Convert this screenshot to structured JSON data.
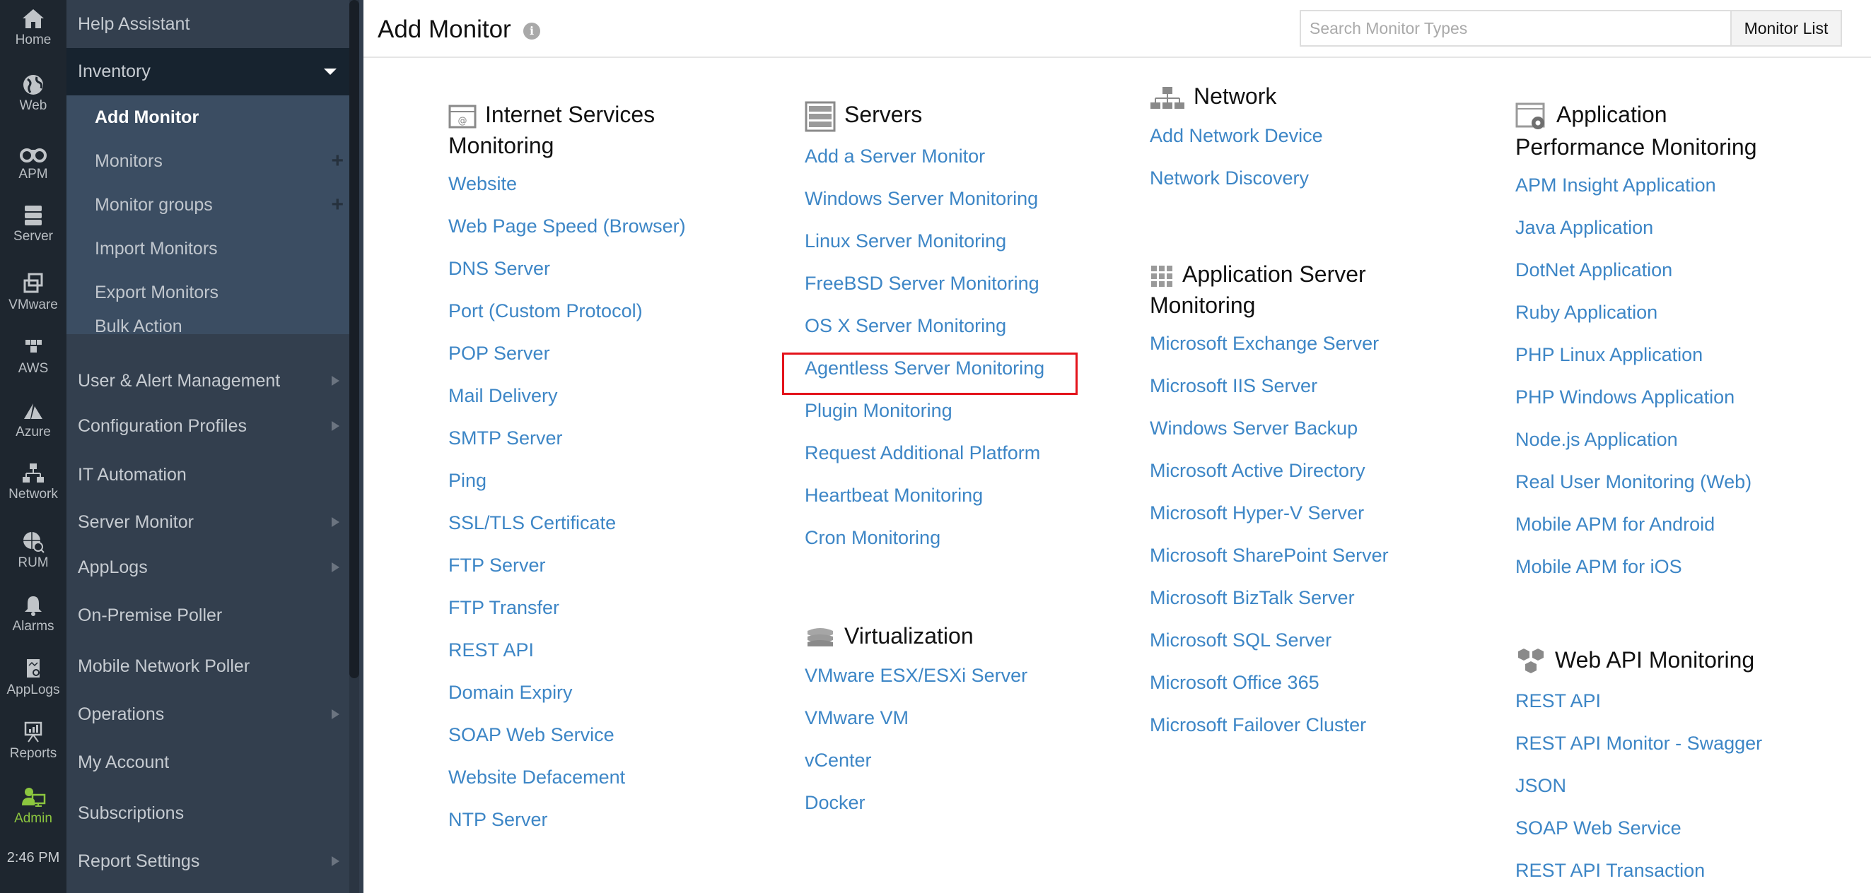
{
  "rail": {
    "items": [
      {
        "label": "Home",
        "icon": "home-icon"
      },
      {
        "label": "Web",
        "icon": "globe-icon"
      },
      {
        "label": "APM",
        "icon": "binoculars-icon"
      },
      {
        "label": "Server",
        "icon": "server-icon"
      },
      {
        "label": "VMware",
        "icon": "vmware-icon"
      },
      {
        "label": "AWS",
        "icon": "aws-cubes-icon"
      },
      {
        "label": "Azure",
        "icon": "azure-icon"
      },
      {
        "label": "Network",
        "icon": "network-icon"
      },
      {
        "label": "RUM",
        "icon": "rum-globe-icon"
      },
      {
        "label": "Alarms",
        "icon": "bell-icon"
      },
      {
        "label": "AppLogs",
        "icon": "applogs-icon"
      },
      {
        "label": "Reports",
        "icon": "reports-icon"
      },
      {
        "label": "Admin",
        "icon": "admin-icon",
        "active": true
      }
    ],
    "time": "2:46 PM",
    "active_color": "#8cc63f"
  },
  "nav": {
    "help": "Help Assistant",
    "inventory": "Inventory",
    "inventory_sub": [
      "Add Monitor",
      "Monitors",
      "Monitor groups",
      "Import Monitors",
      "Export Monitors",
      "Bulk Action"
    ],
    "items": [
      {
        "label": "User & Alert Management",
        "has_arrow": true
      },
      {
        "label": "Configuration Profiles",
        "has_arrow": true
      },
      {
        "label": "IT Automation",
        "has_arrow": false
      },
      {
        "label": "Server Monitor",
        "has_arrow": true
      },
      {
        "label": "AppLogs",
        "has_arrow": true
      },
      {
        "label": "On-Premise Poller",
        "has_arrow": false
      },
      {
        "label": "Mobile Network Poller",
        "has_arrow": false
      },
      {
        "label": "Operations",
        "has_arrow": true
      },
      {
        "label": "My Account",
        "has_arrow": false
      },
      {
        "label": "Subscriptions",
        "has_arrow": false
      },
      {
        "label": "Report Settings",
        "has_arrow": true
      }
    ]
  },
  "header": {
    "title": "Add Monitor",
    "search_placeholder": "Search Monitor Types",
    "search_value": "",
    "monitor_list_label": "Monitor List"
  },
  "sections": {
    "internet": {
      "title_line1": "Internet Services",
      "title_line2": "Monitoring",
      "links": [
        "Website",
        "Web Page Speed (Browser)",
        "DNS Server",
        "Port (Custom Protocol)",
        "POP Server",
        "Mail Delivery",
        "SMTP Server",
        "Ping",
        "SSL/TLS Certificate",
        "FTP Server",
        "FTP Transfer",
        "REST API",
        "Domain Expiry",
        "SOAP Web Service",
        "Website Defacement",
        "NTP Server"
      ]
    },
    "servers": {
      "title": "Servers",
      "links": [
        "Add a Server Monitor",
        "Windows Server Monitoring",
        "Linux Server Monitoring",
        "FreeBSD Server Monitoring",
        "OS X Server Monitoring",
        "Agentless Server Monitoring",
        "Plugin Monitoring",
        "Request Additional Platform",
        "Heartbeat Monitoring",
        "Cron Monitoring"
      ],
      "highlighted": "Agentless Server Monitoring"
    },
    "virtualization": {
      "title": "Virtualization",
      "links": [
        "VMware ESX/ESXi Server",
        "VMware VM",
        "vCenter",
        "Docker"
      ]
    },
    "network": {
      "title": "Network",
      "links": [
        "Add Network Device",
        "Network Discovery"
      ]
    },
    "appserver": {
      "title_line1": "Application Server",
      "title_line2": "Monitoring",
      "links": [
        "Microsoft Exchange Server",
        "Microsoft IIS Server",
        "Windows Server Backup",
        "Microsoft Active Directory",
        "Microsoft Hyper-V Server",
        "Microsoft SharePoint Server",
        "Microsoft BizTalk Server",
        "Microsoft SQL Server",
        "Microsoft Office 365",
        "Microsoft Failover Cluster"
      ]
    },
    "apm": {
      "title_line1": "Application",
      "title_line2": "Performance Monitoring",
      "links": [
        "APM Insight Application",
        "Java Application",
        "DotNet Application",
        "Ruby Application",
        "PHP Linux Application",
        "PHP Windows Application",
        "Node.js Application",
        "Real User Monitoring (Web)",
        "Mobile APM for Android",
        "Mobile APM for iOS"
      ]
    },
    "webapi": {
      "title": "Web API Monitoring",
      "links": [
        "REST API",
        "REST API Monitor - Swagger",
        "JSON",
        "SOAP Web Service",
        "REST API Transaction"
      ]
    }
  },
  "colors": {
    "link": "#3d86c6",
    "highlight_box": "#e3131b",
    "rail_bg": "#1e262f",
    "nav_bg": "#333f4e"
  }
}
